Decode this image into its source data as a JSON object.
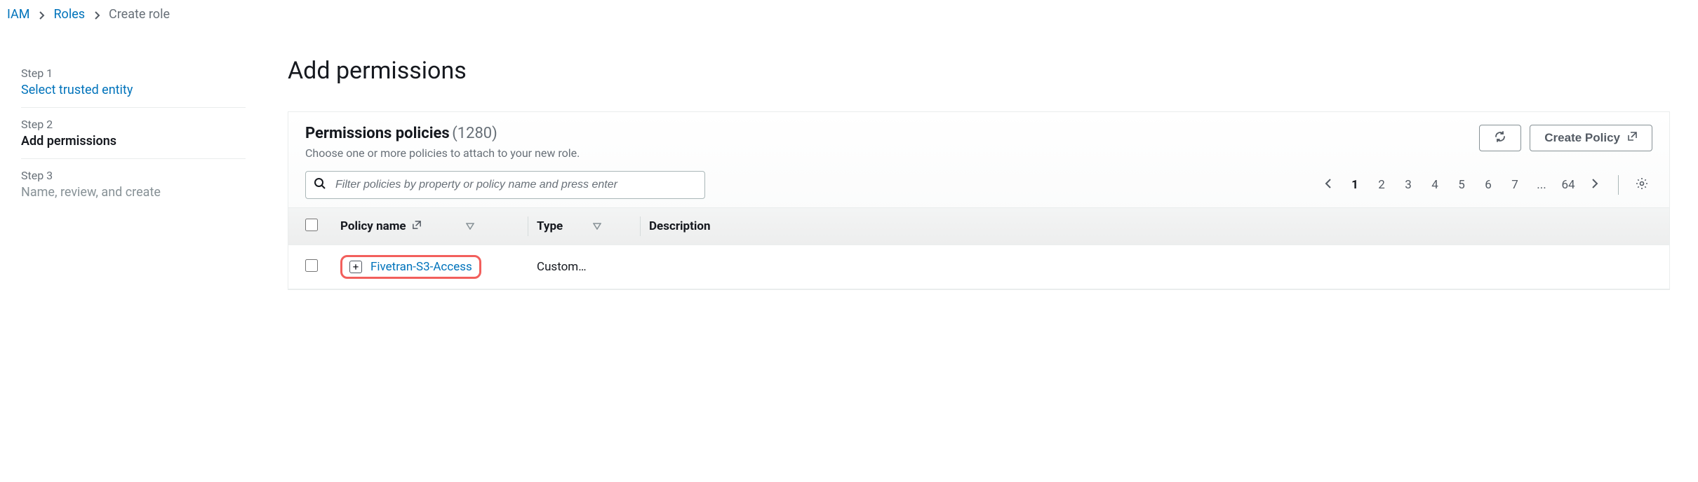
{
  "breadcrumb": {
    "root": "IAM",
    "mid": "Roles",
    "current": "Create role"
  },
  "sidebar": {
    "step1_num": "Step 1",
    "step1_title": "Select trusted entity",
    "step2_num": "Step 2",
    "step2_title": "Add permissions",
    "step3_num": "Step 3",
    "step3_title": "Name, review, and create"
  },
  "page_title": "Add permissions",
  "panel": {
    "title": "Permissions policies",
    "count": "(1280)",
    "desc": "Choose one or more policies to attach to your new role.",
    "create_btn": "Create Policy"
  },
  "search": {
    "placeholder": "Filter policies by property or policy name and press enter"
  },
  "pagination": {
    "p1": "1",
    "p2": "2",
    "p3": "3",
    "p4": "4",
    "p5": "5",
    "p6": "6",
    "p7": "7",
    "ell": "...",
    "last": "64"
  },
  "columns": {
    "name": "Policy name",
    "type": "Type",
    "desc": "Description"
  },
  "row": {
    "name": "Fivetran-S3-Access",
    "type": "Custom…",
    "desc": ""
  }
}
